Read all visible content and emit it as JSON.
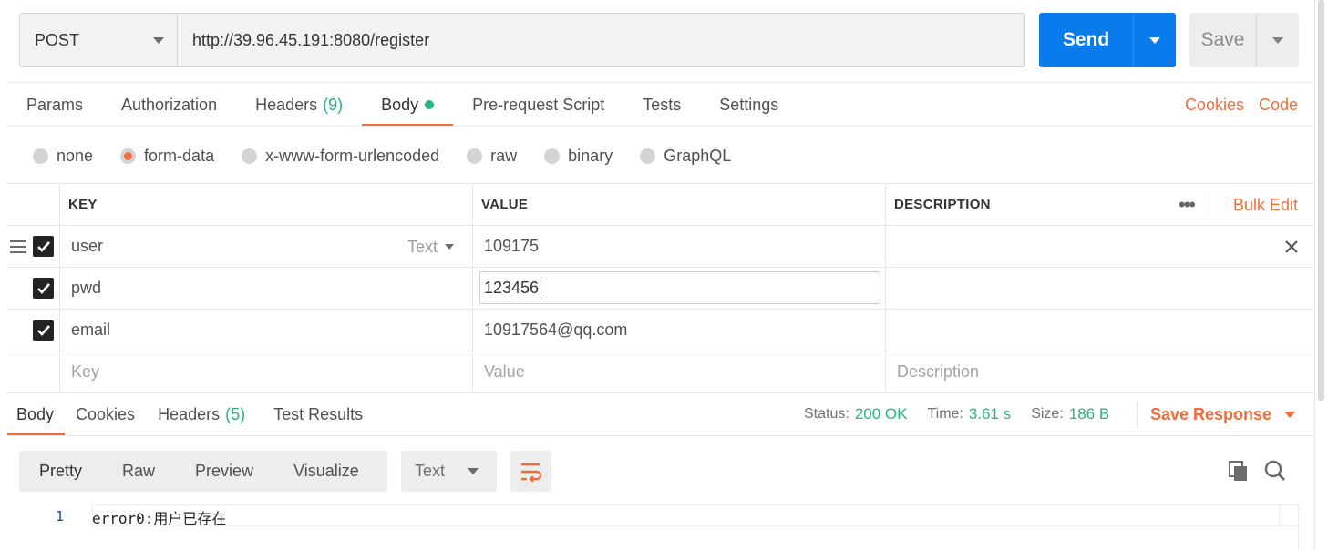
{
  "request": {
    "method": "POST",
    "url": "http://39.96.45.191:8080/register",
    "send_label": "Send",
    "save_label": "Save"
  },
  "request_tabs": [
    {
      "label": "Params"
    },
    {
      "label": "Authorization"
    },
    {
      "label": "Headers",
      "count": "(9)"
    },
    {
      "label": "Body",
      "active": true,
      "indicator": "green-dot"
    },
    {
      "label": "Pre-request Script"
    },
    {
      "label": "Tests"
    },
    {
      "label": "Settings"
    }
  ],
  "right_links": {
    "cookies": "Cookies",
    "code": "Code"
  },
  "body_types": [
    {
      "label": "none"
    },
    {
      "label": "form-data",
      "checked": true
    },
    {
      "label": "x-www-form-urlencoded"
    },
    {
      "label": "raw"
    },
    {
      "label": "binary"
    },
    {
      "label": "GraphQL"
    }
  ],
  "form_table": {
    "headers": {
      "key": "KEY",
      "value": "VALUE",
      "description": "DESCRIPTION"
    },
    "more_label": "•••",
    "bulk_edit": "Bulk Edit",
    "rows": [
      {
        "key": "user",
        "type": "Text",
        "value": "109175",
        "description": "",
        "checked": true
      },
      {
        "key": "pwd",
        "value": "123456",
        "description": "",
        "checked": true,
        "editing": true
      },
      {
        "key": "email",
        "value": "10917564@qq.com",
        "description": "",
        "checked": true
      }
    ],
    "placeholders": {
      "key": "Key",
      "value": "Value",
      "description": "Description"
    }
  },
  "response": {
    "tabs": [
      {
        "label": "Body",
        "active": true
      },
      {
        "label": "Cookies"
      },
      {
        "label": "Headers",
        "count": "(5)"
      },
      {
        "label": "Test Results"
      }
    ],
    "status_label": "Status:",
    "status_value": "200 OK",
    "time_label": "Time:",
    "time_value": "3.61 s",
    "size_label": "Size:",
    "size_value": "186 B",
    "save_response": "Save Response",
    "views": [
      "Pretty",
      "Raw",
      "Preview",
      "Visualize"
    ],
    "format": "Text",
    "code_lines": [
      {
        "number": "1",
        "text": "error0:用户已存在"
      }
    ]
  },
  "icons": {
    "method_dropdown": "chevron-down-icon",
    "drag_handle": "drag-handle-icon",
    "delete_row": "close-icon",
    "wrap": "wrap-lines-icon",
    "copy": "copy-icon",
    "search": "search-icon"
  },
  "colors": {
    "accent": "#f26b3a",
    "send_blue": "#097bed",
    "success_green": "#26b47f"
  }
}
